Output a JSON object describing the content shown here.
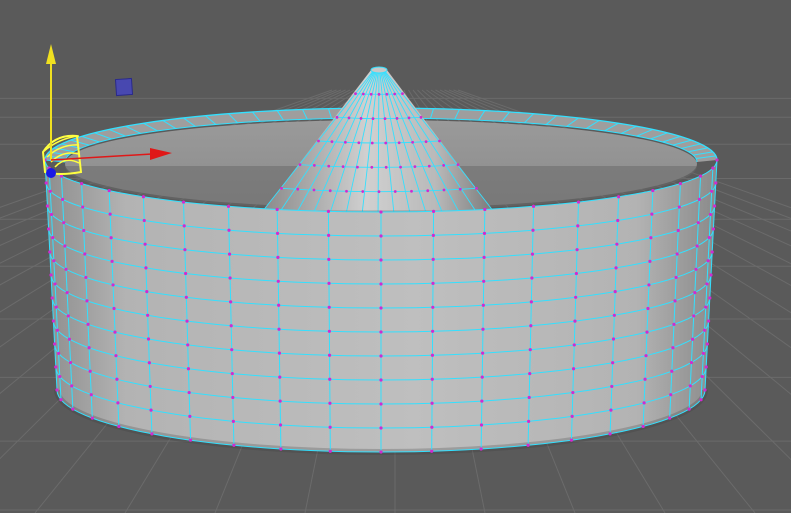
{
  "app": {
    "panel": "3d-viewport",
    "colors": {
      "background": "#5a5a5a",
      "grid_line": "#6b6b6b",
      "mesh_surface": "#a9a9a9",
      "wireframe": "#33e0ff",
      "vertex": "#d02bd0",
      "manip_x": "#e01818",
      "manip_y": "#f0e020",
      "manip_z": "#1a1ae6",
      "selection": "#ffff40"
    }
  },
  "viewport": {
    "content": [
      {
        "name": "ground-grid",
        "type": "grid"
      },
      {
        "name": "cylinder-mesh",
        "type": "polygon-mesh",
        "rings": 10,
        "segments": 20
      },
      {
        "name": "cone-mesh",
        "type": "polygon-mesh",
        "rings": 6
      },
      {
        "name": "move-manipulator",
        "type": "transform-gizmo"
      }
    ]
  }
}
